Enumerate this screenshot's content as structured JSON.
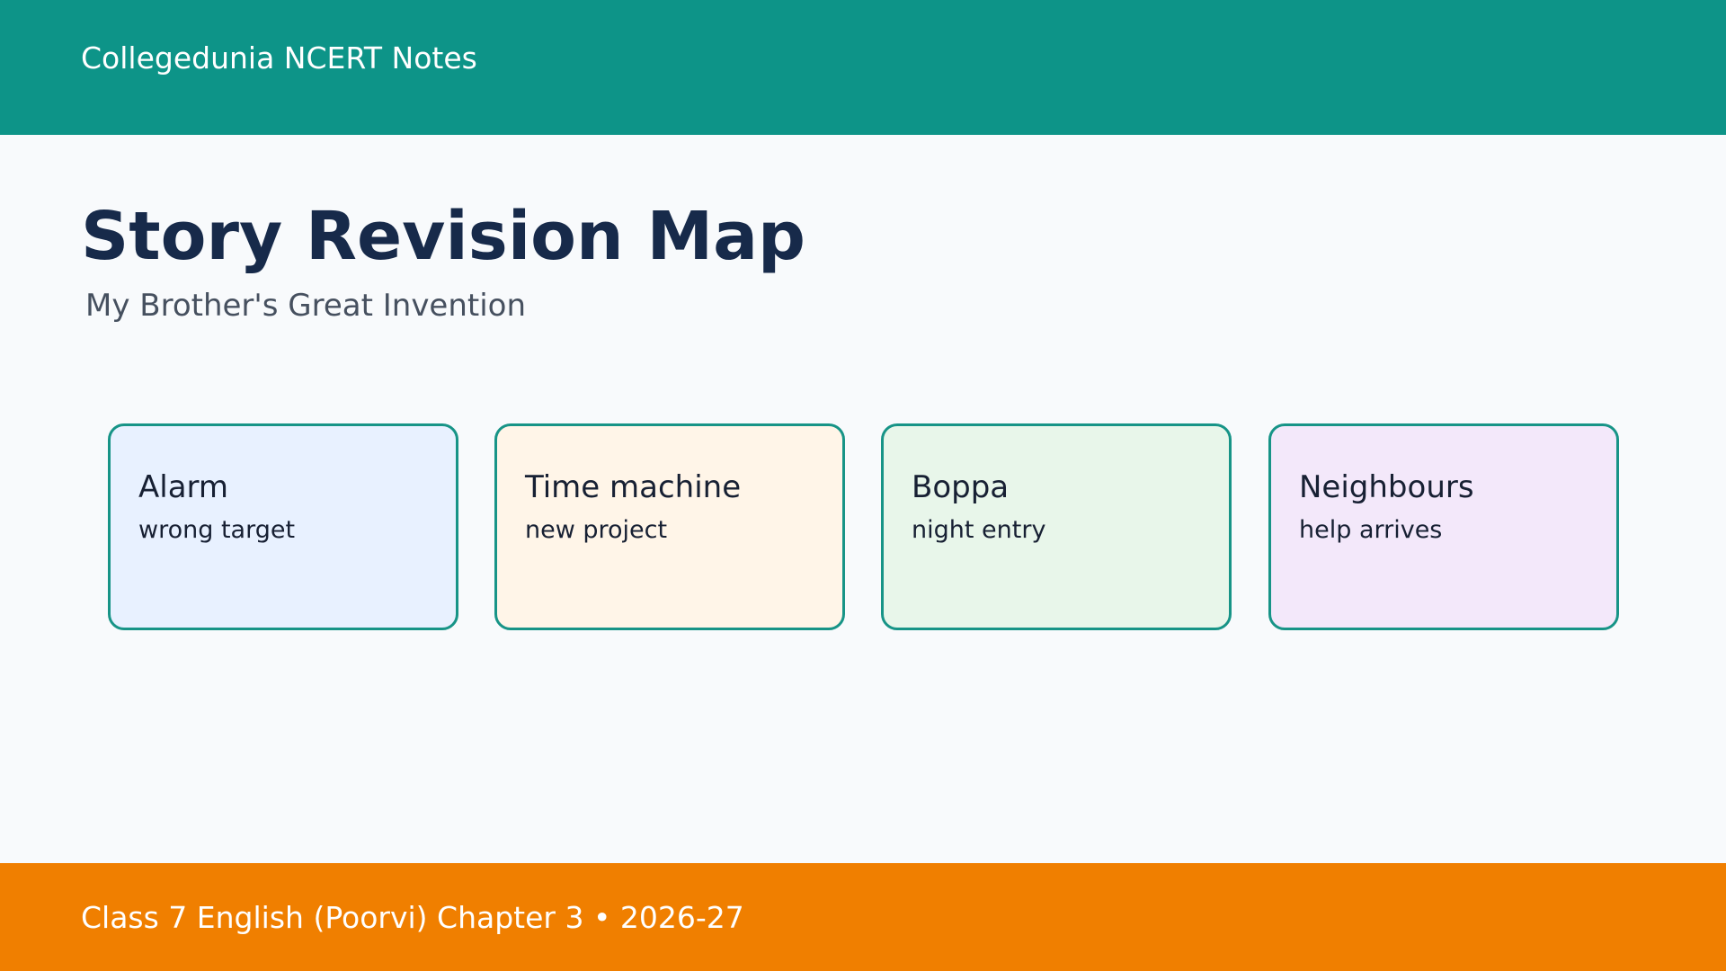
{
  "header": {
    "title": "Collegedunia NCERT Notes",
    "color": "#0d9488"
  },
  "main": {
    "title": "Story Revision Map",
    "subtitle": "My Brother's Great Invention"
  },
  "cards": [
    {
      "title": "Alarm",
      "subtitle": "wrong target",
      "color": "#e8f1ff"
    },
    {
      "title": "Time machine",
      "subtitle": "new project",
      "color": "#fff5e8"
    },
    {
      "title": "Boppa",
      "subtitle": "night entry",
      "color": "#e8f6ea"
    },
    {
      "title": "Neighbours",
      "subtitle": "help arrives",
      "color": "#f3e8fa"
    }
  ],
  "card_border_color": "#179487",
  "footer": {
    "text": "Class 7 English (Poorvi) Chapter 3 • 2026-27",
    "color": "#f07f00"
  }
}
